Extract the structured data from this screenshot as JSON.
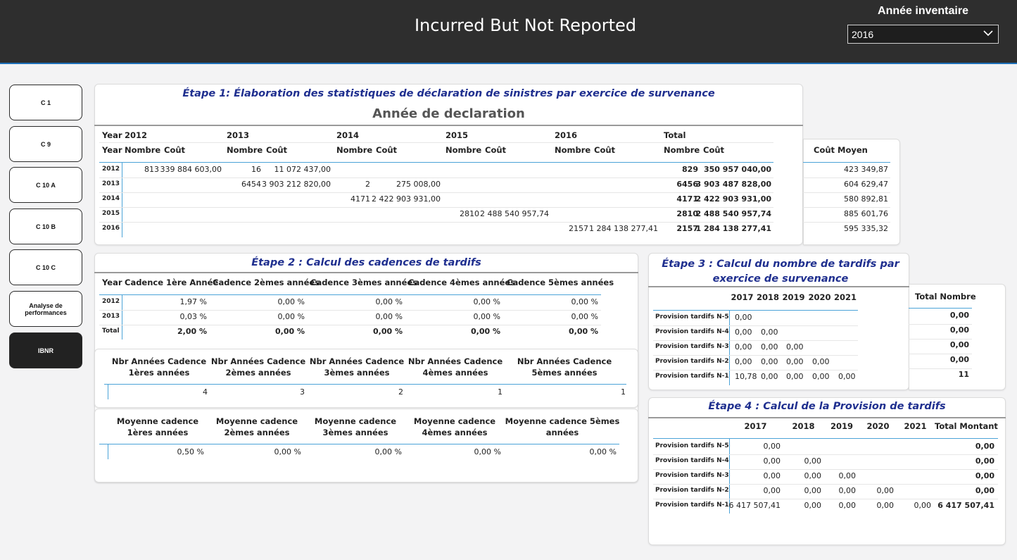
{
  "header": {
    "title": "Incurred But Not Reported",
    "year_label": "Année inventaire",
    "year_value": "2016"
  },
  "nav": [
    "C 1",
    "C 9",
    "C 10 A",
    "C 10 B",
    "C 10 C",
    "Analyse de performances",
    "IBNR"
  ],
  "etape1": {
    "title": "Étape 1: Élaboration des statistiques de déclaration de sinistres par exercice de survenance",
    "subtitle": "Année de declaration",
    "year_hdr": "Year",
    "years": [
      "2012",
      "2013",
      "2014",
      "2015",
      "2016",
      "Total"
    ],
    "nombre": "Nombre",
    "cout": "Coût",
    "rows": [
      [
        "2012",
        "813",
        "339 884 603,00",
        "16",
        "11 072 437,00",
        "",
        "",
        "",
        "",
        "",
        "",
        "829",
        "350 957 040,00"
      ],
      [
        "2013",
        "",
        "",
        "6454",
        "3 903 212 820,00",
        "2",
        "275 008,00",
        "",
        "",
        "",
        "",
        "6456",
        "3 903 487 828,00"
      ],
      [
        "2014",
        "",
        "",
        "",
        "",
        "4171",
        "2 422 903 931,00",
        "",
        "",
        "",
        "",
        "4171",
        "2 422 903 931,00"
      ],
      [
        "2015",
        "",
        "",
        "",
        "",
        "",
        "",
        "2810",
        "2 488 540 957,74",
        "",
        "",
        "2810",
        "2 488 540 957,74"
      ],
      [
        "2016",
        "",
        "",
        "",
        "",
        "",
        "",
        "",
        "",
        "2157",
        "1 284 138 277,41",
        "2157",
        "1 284 138 277,41"
      ]
    ],
    "cout_moyen_hdr": "Coût Moyen",
    "cout_moyen": [
      "423 349,87",
      "604 629,47",
      "580 892,81",
      "885 601,76",
      "595 335,32"
    ]
  },
  "etape2": {
    "title": "Étape 2 : Calcul des cadences de tardifs",
    "headers": [
      "Year",
      "Cadence 1ère Année",
      "Cadence 2èmes années",
      "Cadence 3èmes années",
      "Cadence 4èmes années",
      "Cadence 5èmes années"
    ],
    "rows": [
      [
        "2012",
        "1,97 %",
        "0,00 %",
        "0,00 %",
        "0,00 %",
        "0,00 %"
      ],
      [
        "2013",
        "0,03 %",
        "0,00 %",
        "0,00 %",
        "0,00 %",
        "0,00 %"
      ],
      [
        "Total",
        "2,00 %",
        "0,00 %",
        "0,00 %",
        "0,00 %",
        "0,00 %"
      ]
    ],
    "nbr_headers": [
      "Nbr Années Cadence 1ères années",
      "Nbr Années Cadence 2èmes années",
      "Nbr Années Cadence 3èmes années",
      "Nbr Années Cadence 4èmes années",
      "Nbr Années Cadence 5èmes années"
    ],
    "nbr_values": [
      "4",
      "3",
      "2",
      "1",
      "1"
    ],
    "moy_headers": [
      "Moyenne cadence 1ères années",
      "Moyenne cadence 2èmes années",
      "Moyenne cadence 3èmes années",
      "Moyenne cadence 4èmes années",
      "Moyenne cadence 5èmes années"
    ],
    "moy_values": [
      "0,50 %",
      "0,00 %",
      "0,00 %",
      "0,00 %",
      "0,00 %"
    ]
  },
  "etape3": {
    "title": "Étape 3 : Calcul du nombre de tardifs par exercice de survenance",
    "years": [
      "2017",
      "2018",
      "2019",
      "2020",
      "2021"
    ],
    "labels": [
      "Provision tardifs N-5",
      "Provision tardifs N-4",
      "Provision tardifs N-3",
      "Provision tardifs N-2",
      "Provision tardifs N-1"
    ],
    "rows": [
      [
        "0,00",
        "",
        "",
        "",
        ""
      ],
      [
        "0,00",
        "0,00",
        "",
        "",
        ""
      ],
      [
        "0,00",
        "0,00",
        "0,00",
        "",
        ""
      ],
      [
        "0,00",
        "0,00",
        "0,00",
        "0,00",
        ""
      ],
      [
        "10,78",
        "0,00",
        "0,00",
        "0,00",
        "0,00"
      ]
    ],
    "total_hdr": "Total Nombre",
    "totals": [
      "0,00",
      "0,00",
      "0,00",
      "0,00",
      "11"
    ]
  },
  "etape4": {
    "title": "Étape 4 : Calcul de la Provision de tardifs",
    "headers": [
      "2017",
      "2018",
      "2019",
      "2020",
      "2021",
      "Total Montant"
    ],
    "labels": [
      "Provision tardifs N-5",
      "Provision tardifs N-4",
      "Provision tardifs N-3",
      "Provision tardifs N-2",
      "Provision tardifs N-1"
    ],
    "rows": [
      [
        "0,00",
        "",
        "",
        "",
        "",
        "0,00"
      ],
      [
        "0,00",
        "0,00",
        "",
        "",
        "",
        "0,00"
      ],
      [
        "0,00",
        "0,00",
        "0,00",
        "",
        "",
        "0,00"
      ],
      [
        "0,00",
        "0,00",
        "0,00",
        "0,00",
        "",
        "0,00"
      ],
      [
        "6 417 507,41",
        "0,00",
        "0,00",
        "0,00",
        "0,00",
        "6 417 507,41"
      ]
    ]
  }
}
